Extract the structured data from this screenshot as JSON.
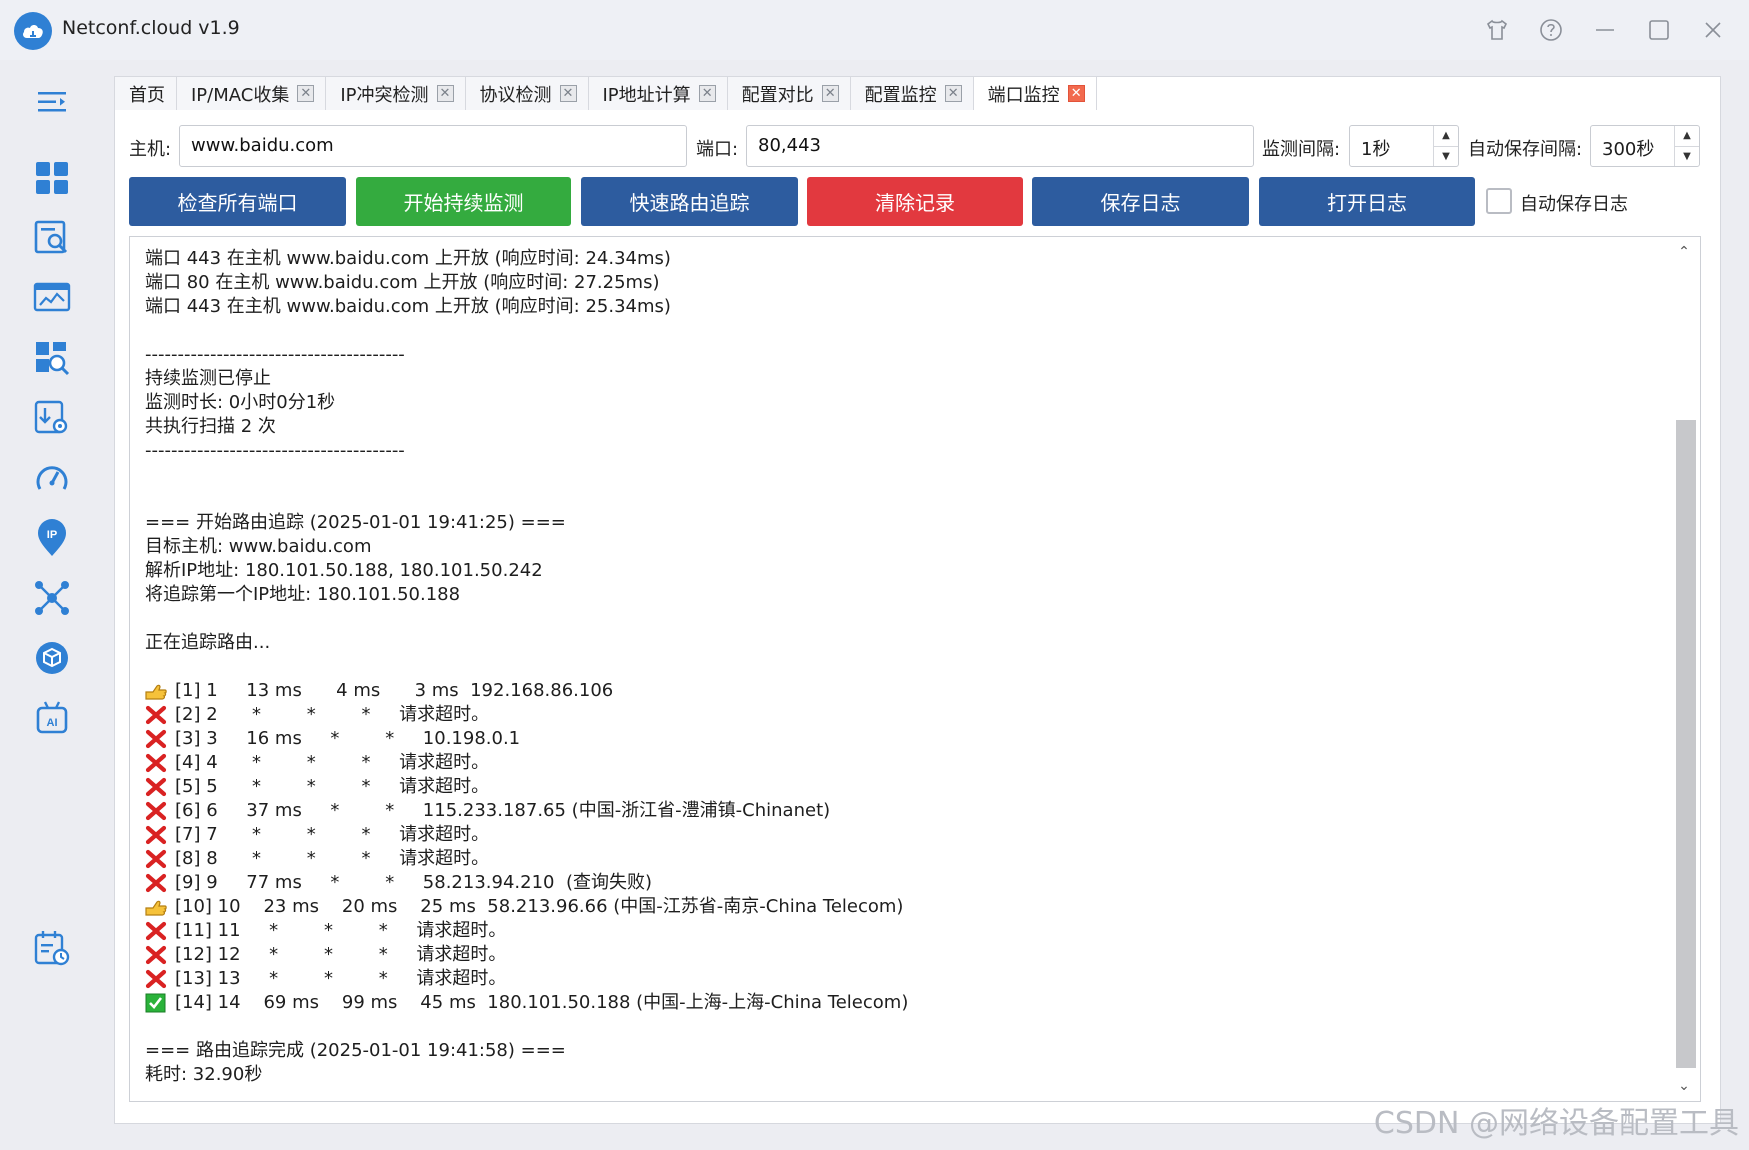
{
  "app": {
    "title": "Netconf.cloud v1.9"
  },
  "tabs": [
    {
      "label": "首页",
      "closable": false,
      "active": false
    },
    {
      "label": "IP/MAC收集",
      "closable": true,
      "active": false
    },
    {
      "label": "IP冲突检测",
      "closable": true,
      "active": false
    },
    {
      "label": "协议检测",
      "closable": true,
      "active": false
    },
    {
      "label": "IP地址计算",
      "closable": true,
      "active": false
    },
    {
      "label": "配置对比",
      "closable": true,
      "active": false
    },
    {
      "label": "配置监控",
      "closable": true,
      "active": false
    },
    {
      "label": "端口监控",
      "closable": true,
      "active": true
    }
  ],
  "tab_close_glyph": "✕",
  "form": {
    "host_label": "主机:",
    "host_value": "www.baidu.com",
    "port_label": "端口:",
    "port_value": "80,443",
    "interval_label": "监测间隔:",
    "interval_value": "1秒",
    "autosave_label": "自动保存间隔:",
    "autosave_value": "300秒",
    "spin_up": "▲",
    "spin_down": "▼"
  },
  "buttons": {
    "check_all": "检查所有端口",
    "start_monitor": "开始持续监测",
    "quick_trace": "快速路由追踪",
    "clear": "清除记录",
    "save_log": "保存日志",
    "open_log": "打开日志",
    "auto_save_label": "自动保存日志"
  },
  "colors": {
    "primary": "#2d5c9f",
    "success": "#34ab3f",
    "danger": "#e2393f",
    "logo": "#2f80d4"
  },
  "log_lines": [
    {
      "icon": "",
      "text": "端口 443 在主机 www.baidu.com 上开放 (响应时间: 24.34ms)"
    },
    {
      "icon": "",
      "text": "端口 80 在主机 www.baidu.com 上开放 (响应时间: 27.25ms)"
    },
    {
      "icon": "",
      "text": "端口 443 在主机 www.baidu.com 上开放 (响应时间: 25.34ms)"
    },
    {
      "icon": "",
      "text": ""
    },
    {
      "icon": "",
      "text": "----------------------------------------"
    },
    {
      "icon": "",
      "text": "持续监测已停止"
    },
    {
      "icon": "",
      "text": "监测时长: 0小时0分1秒"
    },
    {
      "icon": "",
      "text": "共执行扫描 2 次"
    },
    {
      "icon": "",
      "text": "----------------------------------------"
    },
    {
      "icon": "",
      "text": ""
    },
    {
      "icon": "",
      "text": ""
    },
    {
      "icon": "",
      "text": "=== 开始路由追踪 (2025-01-01 19:41:25) ==="
    },
    {
      "icon": "",
      "text": "目标主机: www.baidu.com"
    },
    {
      "icon": "",
      "text": "解析IP地址: 180.101.50.188, 180.101.50.242"
    },
    {
      "icon": "",
      "text": "将追踪第一个IP地址: 180.101.50.188"
    },
    {
      "icon": "",
      "text": ""
    },
    {
      "icon": "",
      "text": "正在追踪路由..."
    },
    {
      "icon": "",
      "text": ""
    },
    {
      "icon": "hand-point-icon",
      "text": "[1] 1     13 ms      4 ms      3 ms  192.168.86.106"
    },
    {
      "icon": "cross-icon",
      "text": "[2] 2      *        *        *     请求超时。"
    },
    {
      "icon": "cross-icon",
      "text": "[3] 3     16 ms     *        *     10.198.0.1"
    },
    {
      "icon": "cross-icon",
      "text": "[4] 4      *        *        *     请求超时。"
    },
    {
      "icon": "cross-icon",
      "text": "[5] 5      *        *        *     请求超时。"
    },
    {
      "icon": "cross-icon",
      "text": "[6] 6     37 ms     *        *     115.233.187.65 (中国-浙江省-澧浦镇-Chinanet)"
    },
    {
      "icon": "cross-icon",
      "text": "[7] 7      *        *        *     请求超时。"
    },
    {
      "icon": "cross-icon",
      "text": "[8] 8      *        *        *     请求超时。"
    },
    {
      "icon": "cross-icon",
      "text": "[9] 9     77 ms     *        *     58.213.94.210  (查询失败)"
    },
    {
      "icon": "hand-point-icon",
      "text": "[10] 10    23 ms    20 ms    25 ms  58.213.96.66 (中国-江苏省-南京-China Telecom)"
    },
    {
      "icon": "cross-icon",
      "text": "[11] 11     *        *        *     请求超时。"
    },
    {
      "icon": "cross-icon",
      "text": "[12] 12     *        *        *     请求超时。"
    },
    {
      "icon": "cross-icon",
      "text": "[13] 13     *        *        *     请求超时。"
    },
    {
      "icon": "check-icon",
      "text": "[14] 14    69 ms    99 ms    45 ms  180.101.50.188 (中国-上海-上海-China Telecom)"
    },
    {
      "icon": "",
      "text": ""
    },
    {
      "icon": "",
      "text": "=== 路由追踪完成 (2025-01-01 19:41:58) ==="
    },
    {
      "icon": "",
      "text": "耗时: 32.90秒"
    }
  ],
  "watermark": "CSDN @网络设备配置工具"
}
